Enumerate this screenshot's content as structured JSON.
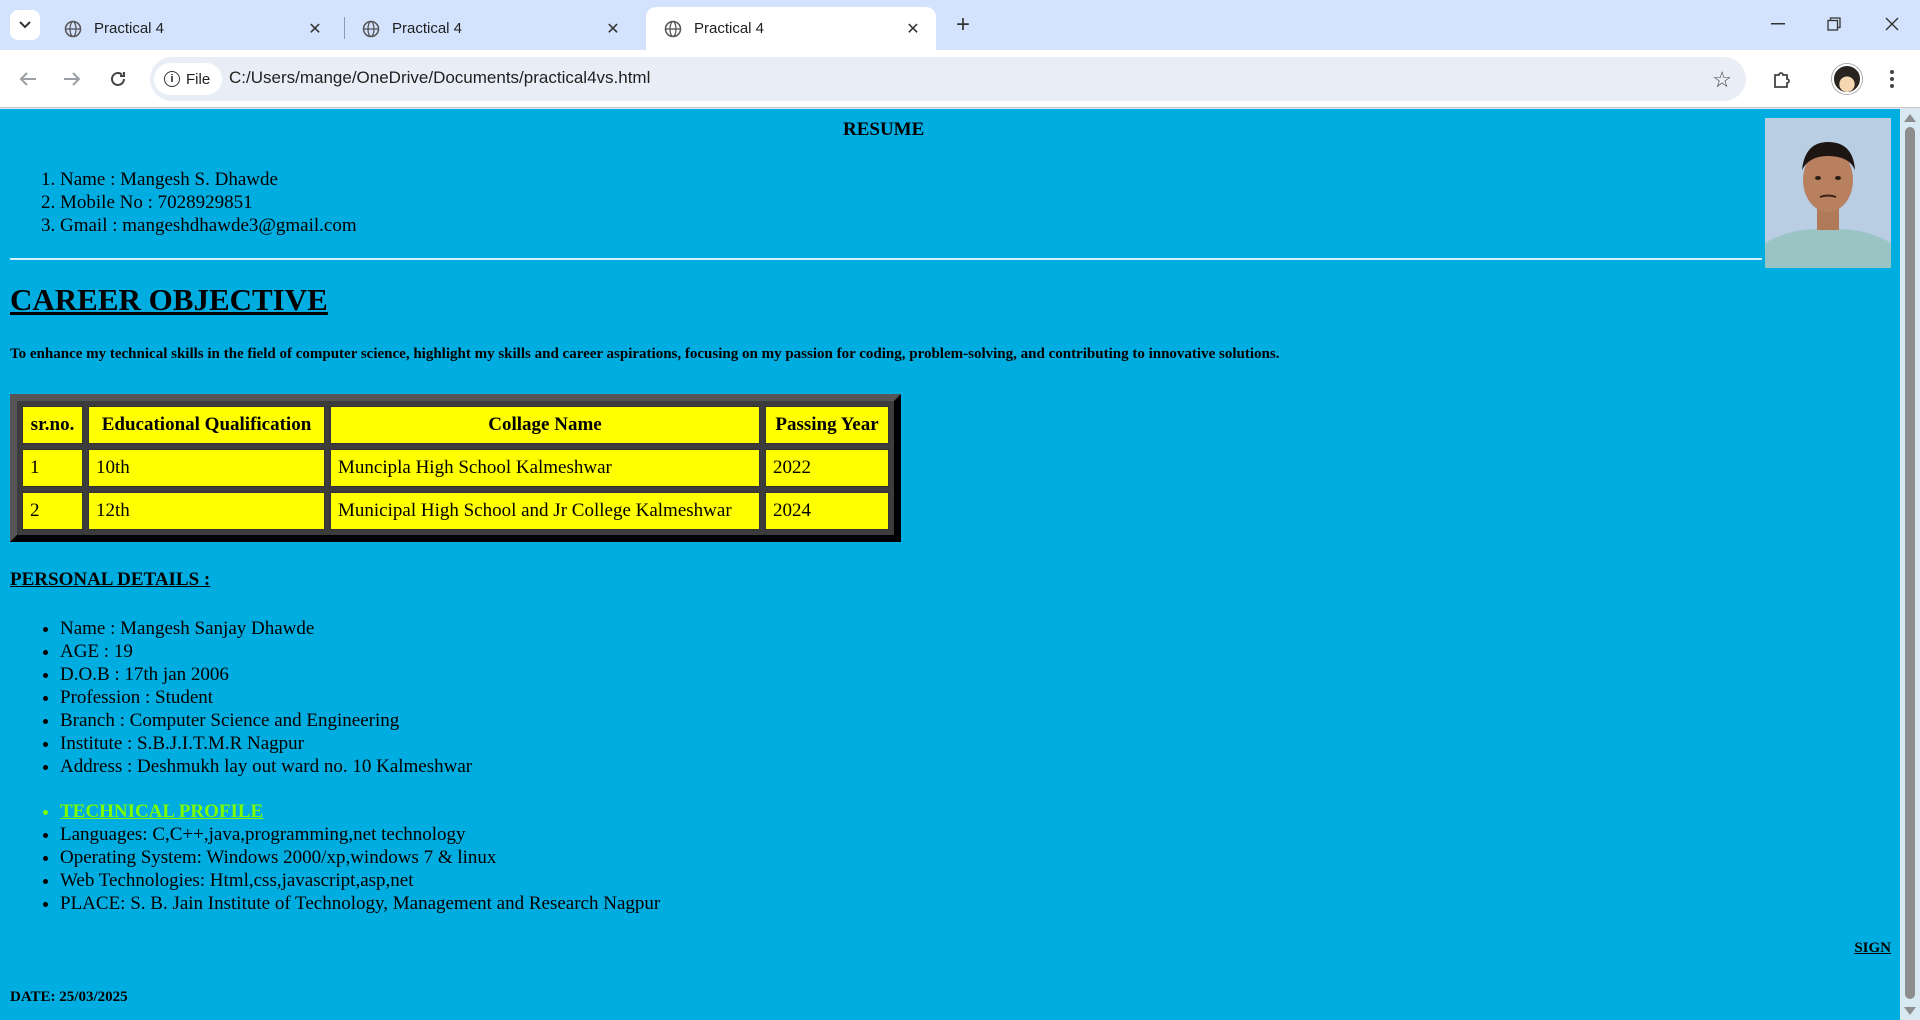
{
  "browser": {
    "tabs": [
      {
        "title": "Practical 4",
        "active": false
      },
      {
        "title": "Practical 4",
        "active": false
      },
      {
        "title": "Practical 4",
        "active": true
      }
    ],
    "site_chip_label": "File",
    "url": "C:/Users/mange/OneDrive/Documents/practical4vs.html"
  },
  "page": {
    "heading": "RESUME",
    "contact": [
      "Name : Mangesh S. Dhawde",
      "Mobile No : 7028929851",
      "Gmail : mangeshdhawde3@gmail.com"
    ],
    "career_title": "CAREER OBJECTIVE",
    "career_text": "To enhance my technical skills in the field of computer science, highlight my skills and career aspirations, focusing on my passion for coding, problem-solving, and contributing to innovative solutions.",
    "education": {
      "headers": [
        "sr.no.",
        "Educational Qualification",
        "Collage Name",
        "Passing Year"
      ],
      "rows": [
        [
          "1",
          "10th",
          "Muncipla High School Kalmeshwar",
          "2022"
        ],
        [
          "2",
          "12th",
          "Municipal High School and Jr College Kalmeshwar",
          "2024"
        ]
      ]
    },
    "personal_title": "PERSONAL DETAILS :",
    "personal_items": [
      "Name : Mangesh Sanjay Dhawde",
      "AGE : 19",
      "D.O.B : 17th jan 2006",
      "Profession : Student",
      "Branch : Computer Science and Engineering",
      "Institute : S.B.J.I.T.M.R Nagpur",
      "Address : Deshmukh lay out ward no. 10 Kalmeshwar"
    ],
    "tech_title": "TECHNICAL PROFILE",
    "tech_items": [
      "Languages: C,C++,java,programming,net technology",
      "Operating System: Windows 2000/xp,windows 7 & linux",
      "Web Technologies: Html,css,javascript,asp,net",
      "PLACE: S. B. Jain Institute of Technology, Management and Research Nagpur"
    ],
    "sign_label": "SIGN",
    "date_label": "DATE: 25/03/2025"
  },
  "colors": {
    "page_background": "#00ade0",
    "table_cell": "#ffff00",
    "tech_heading": "#7cff00"
  }
}
